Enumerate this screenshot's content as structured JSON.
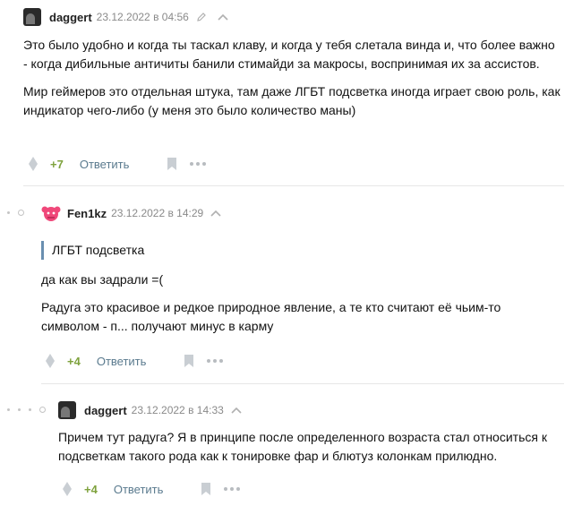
{
  "comments": [
    {
      "author": "daggert",
      "date": "23.12.2022 в 04:56",
      "paragraphs": [
        "Это было удобно и когда ты таскал клаву, и когда у тебя слетала винда и, что более важно - когда дибильные античиты банили стимайди за макросы, воспринимая их за ассистов.",
        "Мир геймеров это отдельная штука, там даже ЛГБТ подсветка иногда играет свою роль, как индикатор чего-либо (у меня это было количество маны)"
      ],
      "rating": "+7",
      "reply_label": "Ответить"
    },
    {
      "author": "Fen1kz",
      "date": "23.12.2022 в 14:29",
      "quote": "ЛГБТ подсветка",
      "paragraphs": [
        "да как вы задрали =(",
        "Радуга это красивое и редкое природное явление, а те кто считают её чьим-то символом - п... получают минус в карму"
      ],
      "rating": "+4",
      "reply_label": "Ответить"
    },
    {
      "author": "daggert",
      "date": "23.12.2022 в 14:33",
      "paragraphs": [
        "Причем тут радуга? Я в принципе после определенного возраста стал относиться к подсветкам такого рода как к тонировке фар и блютуз колонкам прилюдно."
      ],
      "rating": "+4",
      "reply_label": "Ответить"
    }
  ],
  "colors": {
    "rating": "#7ea23d",
    "reply": "#5a7a8e",
    "quote_bar": "#6a8fb0",
    "icons": "#c4c4c4"
  }
}
